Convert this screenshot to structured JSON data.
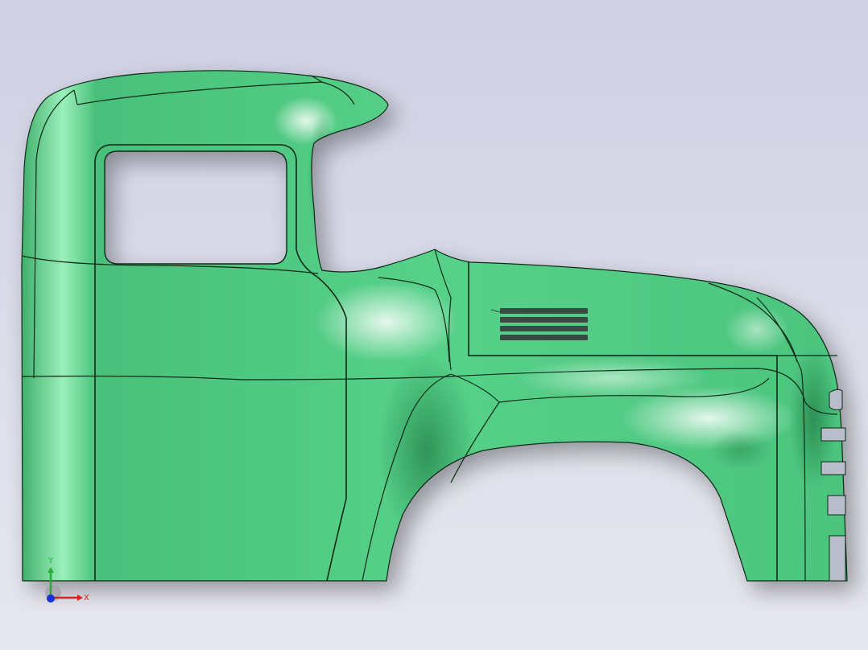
{
  "viewport": {
    "background_top": "#cfd0e4",
    "background_bottom": "#e7e8ee"
  },
  "model": {
    "body_color": "#55d088",
    "body_shadow": "#2f9e5c",
    "body_highlight": "#ffffff",
    "edge_color": "#0e2a17",
    "vent_color": "#3b4a44"
  },
  "triad": {
    "x_label": "X",
    "y_label": "Y",
    "x_color": "#e02020",
    "y_color": "#22b030",
    "z_color": "#1a2fd8"
  }
}
